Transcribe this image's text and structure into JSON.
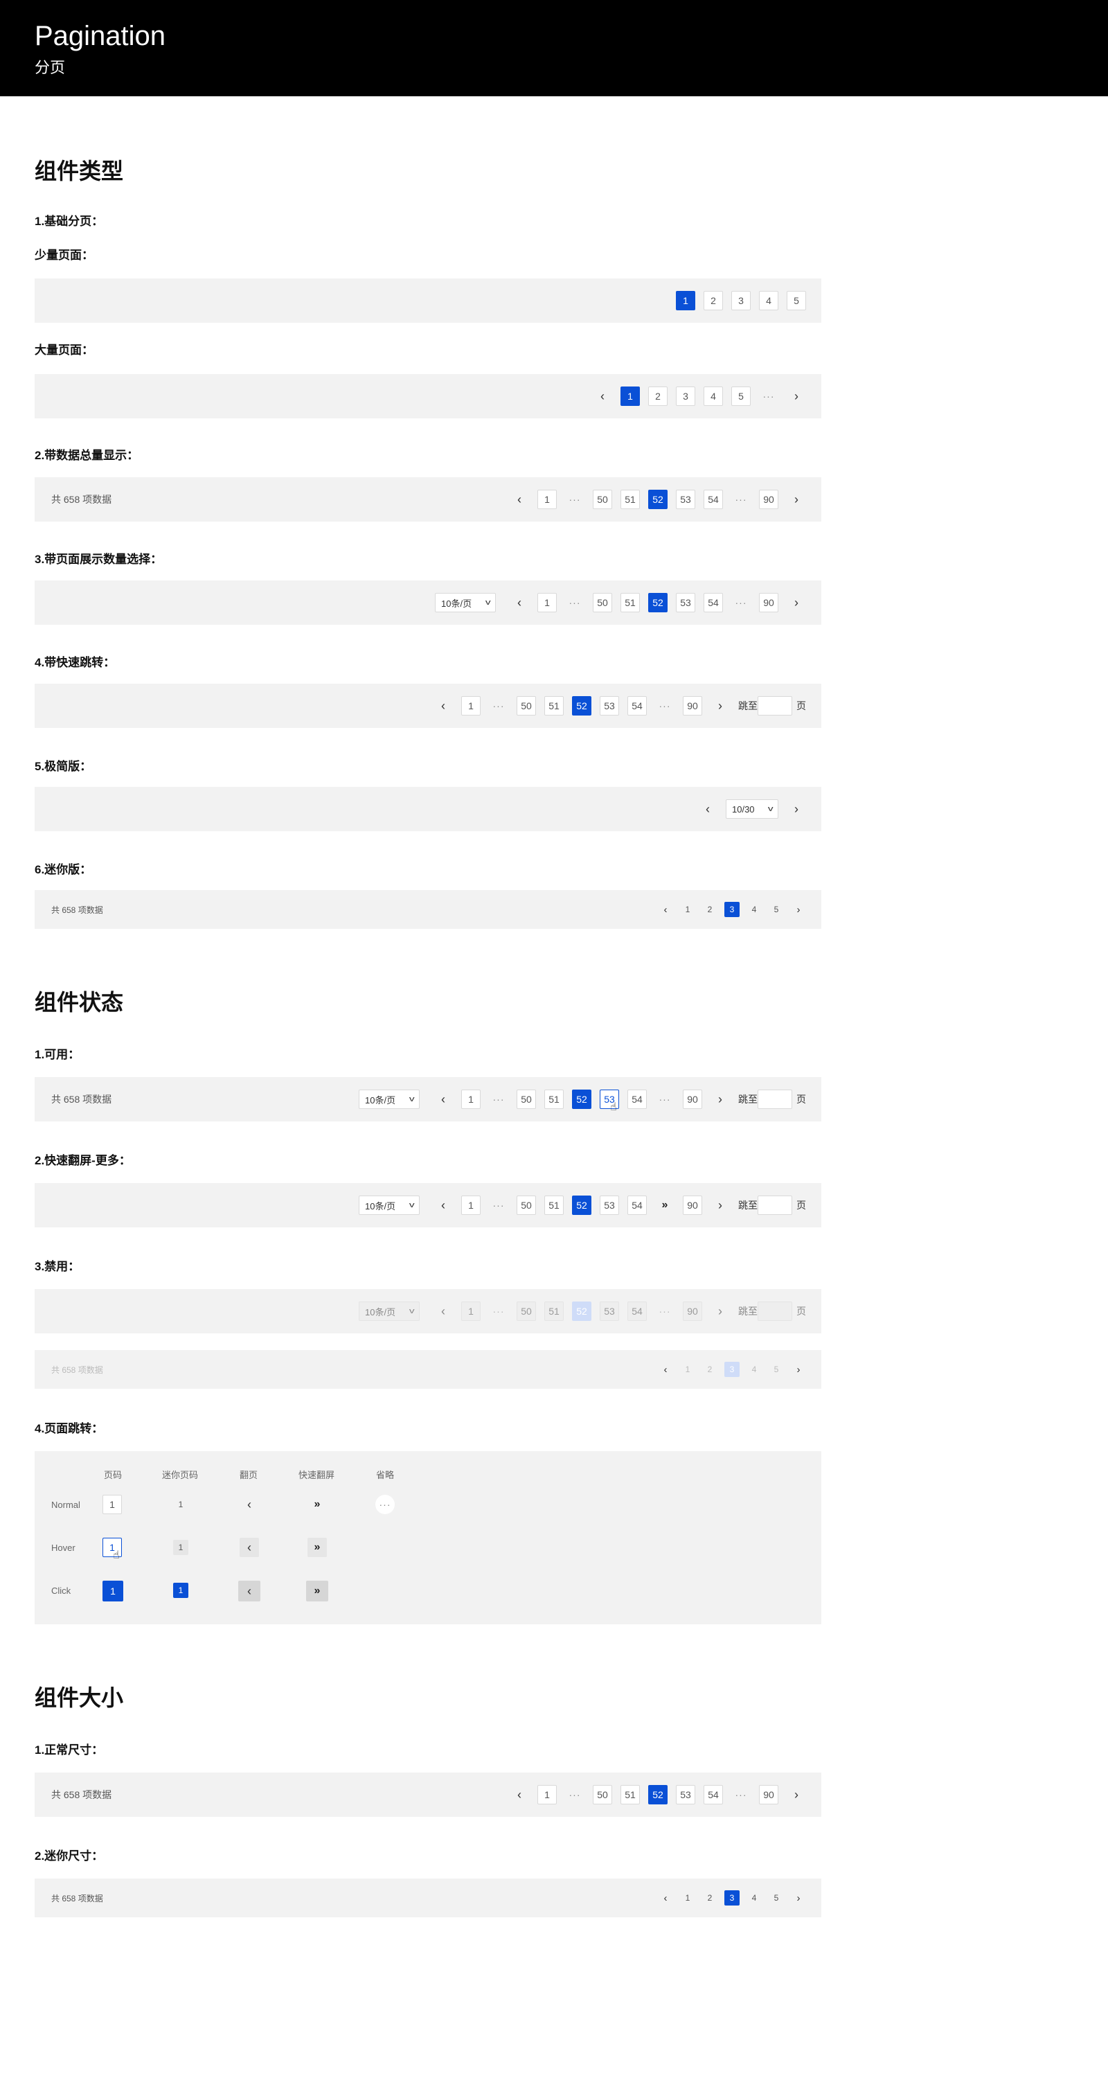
{
  "header": {
    "title": "Pagination",
    "subtitle": "分页"
  },
  "sections": {
    "types": "组件类型",
    "states": "组件状态",
    "sizes": "组件大小"
  },
  "labels": {
    "basic": "1.基础分页：",
    "few": "少量页面：",
    "many": "大量页面：",
    "with_total": "2.带数据总量显示：",
    "with_size": "3.带页面展示数量选择：",
    "with_jump": "4.带快速跳转：",
    "simple": "5.极简版：",
    "mini": "6.迷你版：",
    "available": "1.可用：",
    "fast_more": "2.快速翻屏-更多：",
    "disabled": "3.禁用：",
    "page_jump": "4.页面跳转：",
    "normal_size": "1.正常尺寸：",
    "mini_size": "2.迷你尺寸："
  },
  "common": {
    "total": "共 658 项数据",
    "page_size": "10条/页",
    "jump_to": "跳至",
    "page_unit": "页",
    "simple_value": "10/30",
    "dots": "···",
    "prev": "‹",
    "next": "›",
    "fast": "»"
  },
  "pages_few": [
    "1",
    "2",
    "3",
    "4",
    "5"
  ],
  "pages_long": [
    "1",
    "50",
    "51",
    "52",
    "53",
    "54",
    "90"
  ],
  "pages_mini": [
    "1",
    "2",
    "3",
    "4",
    "5"
  ],
  "matrix": {
    "columns": [
      "页码",
      "迷你页码",
      "翻页",
      "快速翻屏",
      "省略"
    ],
    "rows": [
      "Normal",
      "Hover",
      "Click"
    ],
    "num": "1"
  },
  "colors": {
    "primary": "#0a50d6",
    "panel": "#f2f2f2",
    "header": "#000000"
  }
}
